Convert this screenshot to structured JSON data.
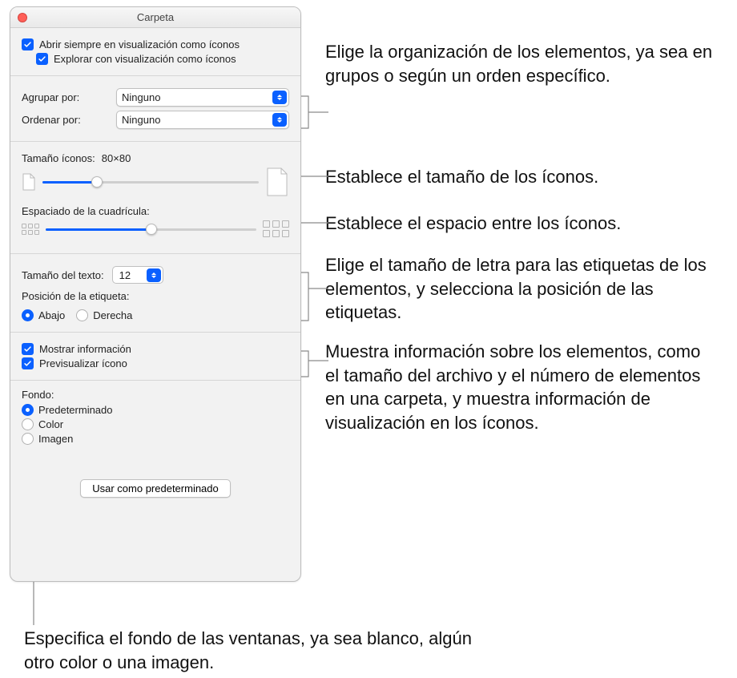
{
  "window": {
    "title": "Carpeta"
  },
  "topchecks": {
    "always_open": "Abrir siempre en visualización como íconos",
    "browse": "Explorar con visualización como íconos"
  },
  "arrange": {
    "group_label": "Agrupar por:",
    "group_value": "Ninguno",
    "sort_label": "Ordenar por:",
    "sort_value": "Ninguno"
  },
  "icon_size": {
    "label": "Tamaño íconos:",
    "value": "80×80"
  },
  "grid": {
    "label": "Espaciado de la cuadrícula:"
  },
  "text": {
    "size_label": "Tamaño del texto:",
    "size_value": "12",
    "pos_label": "Posición de la etiqueta:",
    "pos_bottom": "Abajo",
    "pos_right": "Derecha"
  },
  "info": {
    "show_info": "Mostrar información",
    "preview": "Previsualizar ícono"
  },
  "bg": {
    "title": "Fondo:",
    "default": "Predeterminado",
    "color": "Color",
    "image": "Imagen"
  },
  "footer": {
    "button": "Usar como predeterminado"
  },
  "callouts": {
    "c1": "Elige la organización de los elementos, ya sea en grupos o según un orden específico.",
    "c2": "Establece el tamaño de los íconos.",
    "c3": "Establece el espacio entre los íconos.",
    "c4": "Elige el tamaño de letra para las etiquetas de los elementos, y selecciona la posición de las etiquetas.",
    "c5": "Muestra información sobre los elementos, como el tamaño del archivo y el número de elementos en una carpeta, y muestra información de visualización en los íconos.",
    "c6": "Especifica el fondo de las ventanas, ya sea blanco, algún otro color o una imagen."
  }
}
